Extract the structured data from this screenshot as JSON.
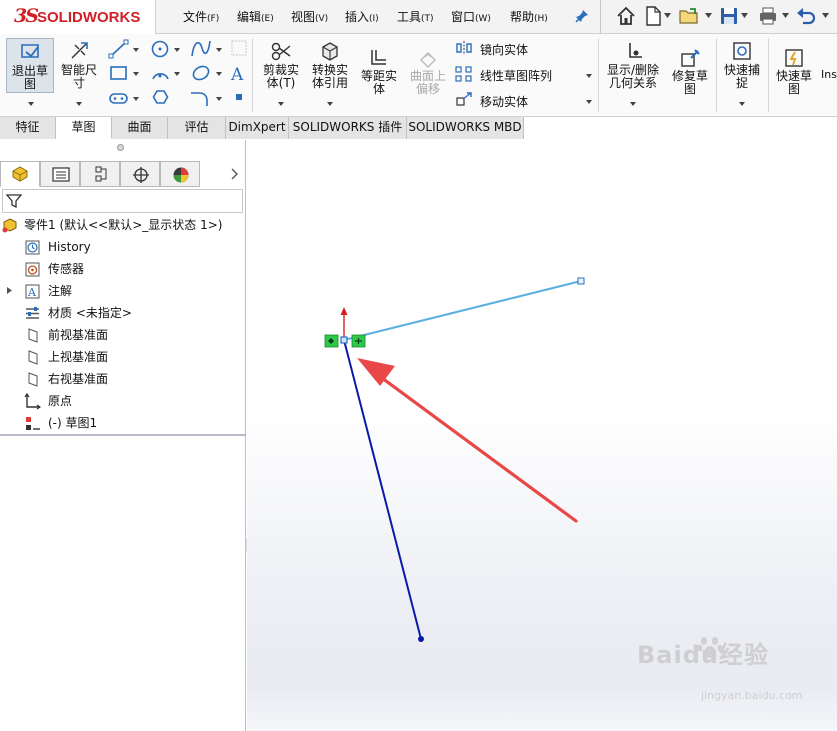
{
  "app": {
    "logo_text": "SOLIDWORKS"
  },
  "menu": {
    "items": [
      {
        "label": "文件",
        "accel": "(F)"
      },
      {
        "label": "编辑",
        "accel": "(E)"
      },
      {
        "label": "视图",
        "accel": "(V)"
      },
      {
        "label": "插入",
        "accel": "(I)"
      },
      {
        "label": "工具",
        "accel": "(T)"
      },
      {
        "label": "窗口",
        "accel": "(W)"
      },
      {
        "label": "帮助",
        "accel": "(H)"
      }
    ]
  },
  "quick_access": {
    "icons": [
      "home-icon",
      "new-file-icon",
      "open-folder-icon",
      "save-icon",
      "print-icon",
      "undo-icon"
    ]
  },
  "ribbon": {
    "exit_sketch": [
      "退出草",
      "图"
    ],
    "smart_dim": [
      "智能尺",
      "寸"
    ],
    "trim": [
      "剪裁实",
      "体(T)"
    ],
    "convert": [
      "转换实",
      "体引用"
    ],
    "offset": [
      "等距实",
      "体"
    ],
    "surface_offset": [
      "曲面上",
      "偏移"
    ],
    "mirror": "镜向实体",
    "linear_pattern": "线性草图阵列",
    "move": "移动实体",
    "show_relations": [
      "显示/删除",
      "几何关系"
    ],
    "repair": [
      "修复草",
      "图"
    ],
    "quick_snap": [
      "快速捕",
      "捉"
    ],
    "rapid_sketch": [
      "快速草",
      "图"
    ],
    "cut_off": "Ins"
  },
  "tabs": [
    {
      "label": "特征",
      "active": false
    },
    {
      "label": "草图",
      "active": true
    },
    {
      "label": "曲面",
      "active": false
    },
    {
      "label": "评估",
      "active": false
    },
    {
      "label": "DimXpert",
      "active": false
    },
    {
      "label": "SOLIDWORKS 插件",
      "active": false
    },
    {
      "label": "SOLIDWORKS MBD",
      "active": false
    }
  ],
  "feature_tree": {
    "root": "零件1 (默认<<默认>_显示状态 1>)",
    "items": [
      {
        "label": "History",
        "icon": "history-icon"
      },
      {
        "label": "传感器",
        "icon": "sensor-icon"
      },
      {
        "label": "注解",
        "icon": "annotation-icon",
        "expandable": true
      },
      {
        "label": "材质 <未指定>",
        "icon": "material-icon"
      },
      {
        "label": "前视基准面",
        "icon": "plane-icon"
      },
      {
        "label": "上视基准面",
        "icon": "plane-icon"
      },
      {
        "label": "右视基准面",
        "icon": "plane-icon"
      },
      {
        "label": "原点",
        "icon": "origin-icon"
      },
      {
        "label": "(-) 草图1",
        "icon": "sketch-icon"
      }
    ]
  },
  "colors": {
    "logo_red": "#d12027",
    "light_line": "#5aaee0",
    "dark_line": "#0a1aa8",
    "arrow_red": "#e84848",
    "relation_green": "#2ec94a"
  },
  "watermark": {
    "brand": "Baidu经验",
    "url": "jingyan.baidu.com"
  }
}
